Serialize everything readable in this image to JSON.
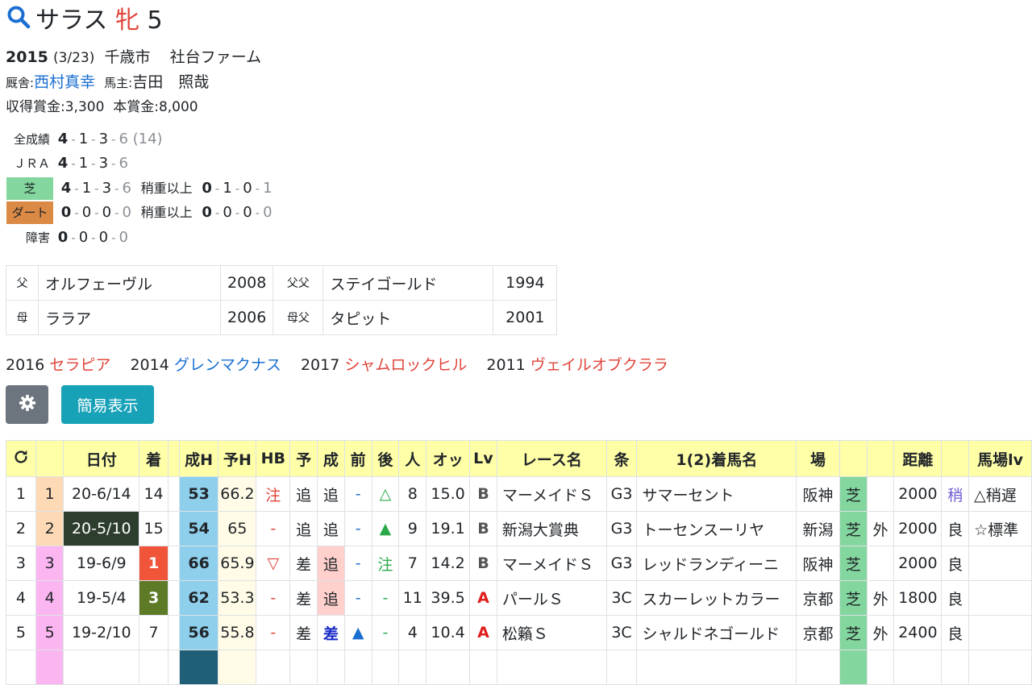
{
  "horse": {
    "name": "サラス",
    "sex": "牝",
    "age": "5"
  },
  "birth": {
    "year": "2015",
    "date": "(3/23)",
    "place": "千歳市",
    "breeder": "社台ファーム"
  },
  "stable": {
    "label": "厩舎:",
    "trainer": "西村真幸",
    "owner_label": "馬主:",
    "owner": "吉田　照哉"
  },
  "earnings": {
    "collected": "収得賞金:3,300",
    "prize": "本賞金:8,000"
  },
  "records": {
    "all": {
      "label": "全成績",
      "w": "4",
      "s": "1",
      "t": "3",
      "o": "6",
      "total": "(14)"
    },
    "jra": {
      "label": "ＪＲＡ",
      "w": "4",
      "s": "1",
      "t": "3",
      "o": "6"
    },
    "turf": {
      "label": "芝",
      "w": "4",
      "s": "1",
      "t": "3",
      "o": "6",
      "heavy_label": "稍重以上",
      "hw": "0",
      "hs": "1",
      "ht": "0",
      "ho": "1"
    },
    "dirt": {
      "label": "ダート",
      "w": "0",
      "s": "0",
      "t": "0",
      "o": "0",
      "heavy_label": "稍重以上",
      "hw": "0",
      "hs": "0",
      "ht": "0",
      "ho": "0"
    },
    "jump": {
      "label": "障害",
      "w": "0",
      "s": "0",
      "t": "0",
      "o": "0"
    },
    "dash": "-"
  },
  "pedigree": {
    "sire_label": "父",
    "sire": "オルフェーヴル",
    "sire_year": "2008",
    "sire_sire_label": "父父",
    "sire_sire": "ステイゴールド",
    "sire_sire_year": "1994",
    "dam_label": "母",
    "dam": "ララア",
    "dam_year": "2006",
    "dam_sire_label": "母父",
    "dam_sire": "タピット",
    "dam_sire_year": "2001"
  },
  "siblings": [
    {
      "year": "2016",
      "name": "セラピア",
      "color": "red"
    },
    {
      "year": "2014",
      "name": "グレンマクナス",
      "color": "blue"
    },
    {
      "year": "2017",
      "name": "シャムロックヒル",
      "color": "red"
    },
    {
      "year": "2011",
      "name": "ヴェイルオブクララ",
      "color": "red"
    }
  ],
  "buttons": {
    "settings_icon": "gear-icon",
    "simple_view": "簡易表示"
  },
  "table": {
    "headers": [
      "",
      "",
      "日付",
      "着",
      "",
      "成H",
      "予H",
      "HB",
      "予",
      "成",
      "前",
      "後",
      "人",
      "オッ",
      "Lv",
      "レース名",
      "条",
      "1(2)着馬名",
      "場",
      "",
      "",
      "距離",
      "",
      "馬場lv"
    ],
    "rows": [
      {
        "n": "1",
        "n2": "1",
        "date": "20-6/14",
        "pos": "14",
        "seiH": "53",
        "yoH": "66.2",
        "hb": "注",
        "yo": "追",
        "sei": "追",
        "mae": "-",
        "ato": "△",
        "nin": "8",
        "odds": "15.0",
        "lv": "B",
        "race": "マーメイドＳ",
        "jo": "G3",
        "winner": "サマーセント",
        "ba": "阪神",
        "surf": "芝",
        "course": "",
        "dist": "2000",
        "cond": "稍",
        "blv": "△稍遅"
      },
      {
        "n": "2",
        "n2": "2",
        "date": "20-5/10",
        "pos": "15",
        "seiH": "54",
        "yoH": "65",
        "hb": "-",
        "yo": "追",
        "sei": "追",
        "mae": "-",
        "ato": "▲",
        "nin": "9",
        "odds": "19.1",
        "lv": "B",
        "race": "新潟大賞典",
        "jo": "G3",
        "winner": "トーセンスーリヤ",
        "ba": "新潟",
        "surf": "芝",
        "course": "外",
        "dist": "2000",
        "cond": "良",
        "blv": "☆標準"
      },
      {
        "n": "3",
        "n2": "3",
        "date": "19-6/9",
        "pos": "1",
        "seiH": "66",
        "yoH": "65.9",
        "hb": "▽",
        "yo": "差",
        "sei": "追",
        "mae": "-",
        "ato": "注",
        "nin": "7",
        "odds": "14.2",
        "lv": "B",
        "race": "マーメイドＳ",
        "jo": "G3",
        "winner": "レッドランディーニ",
        "ba": "阪神",
        "surf": "芝",
        "course": "",
        "dist": "2000",
        "cond": "良",
        "blv": ""
      },
      {
        "n": "4",
        "n2": "4",
        "date": "19-5/4",
        "pos": "3",
        "seiH": "62",
        "yoH": "53.3",
        "hb": "-",
        "yo": "差",
        "sei": "追",
        "mae": "-",
        "ato": "-",
        "nin": "11",
        "odds": "39.5",
        "lv": "A",
        "race": "パールＳ",
        "jo": "3C",
        "winner": "スカーレットカラー",
        "ba": "京都",
        "surf": "芝",
        "course": "外",
        "dist": "1800",
        "cond": "良",
        "blv": ""
      },
      {
        "n": "5",
        "n2": "5",
        "date": "19-2/10",
        "pos": "7",
        "seiH": "56",
        "yoH": "55.8",
        "hb": "-",
        "yo": "差",
        "sei": "差",
        "mae": "▲",
        "ato": "-",
        "nin": "4",
        "odds": "10.4",
        "lv": "A",
        "race": "松籟Ｓ",
        "jo": "3C",
        "winner": "シャルドネゴールド",
        "ba": "京都",
        "surf": "芝",
        "course": "外",
        "dist": "2400",
        "cond": "良",
        "blv": ""
      }
    ]
  }
}
